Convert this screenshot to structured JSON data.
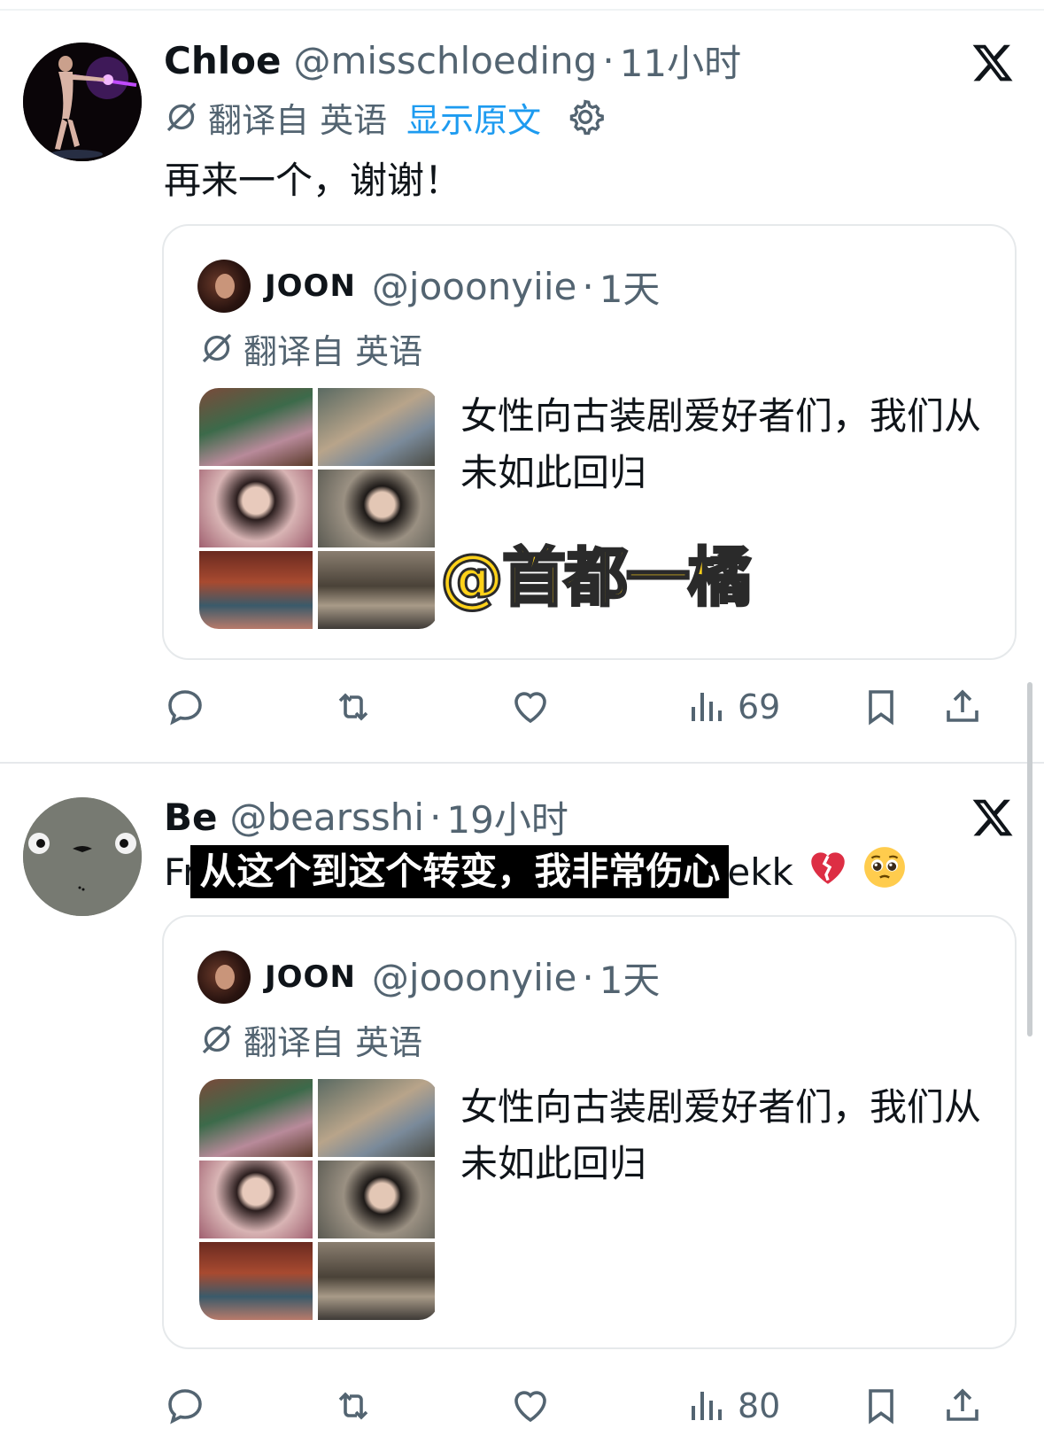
{
  "tweets": [
    {
      "author": {
        "name": "Chloe",
        "handle": "@misschloeding"
      },
      "separator": "·",
      "time": "11小时",
      "translate": {
        "label": "翻译自 英语",
        "show_original": "显示原文"
      },
      "text": "再来一个，谢谢！",
      "quote": {
        "author": {
          "name": "JOON",
          "handle": "@jooonyiie"
        },
        "separator": "·",
        "time": "1天",
        "translate_label": "翻译自 英语",
        "text": "女性向古装剧爱好者们，我们从未如此回归",
        "overlay_tag": "@首都一橘"
      },
      "views": "69"
    },
    {
      "author": {
        "name": "Be",
        "handle": "@bearsshi"
      },
      "separator": "·",
      "time": "19小时",
      "text_prefix": "Fr",
      "subtitle": "从这个到这个转变，我非常伤心",
      "text_suffix": "ekk",
      "emojis": [
        "💔",
        "🥺"
      ],
      "quote": {
        "author": {
          "name": "JOON",
          "handle": "@jooonyiie"
        },
        "separator": "·",
        "time": "1天",
        "translate_label": "翻译自 英语",
        "text": "女性向古装剧爱好者们，我们从未如此回归"
      },
      "views": "80"
    }
  ],
  "icons": {
    "x_logo": "x-logo-icon",
    "translate": "translate-icon",
    "settings": "gear-icon",
    "reply": "reply-icon",
    "retweet": "retweet-icon",
    "like": "heart-icon",
    "views": "views-icon",
    "bookmark": "bookmark-icon",
    "share": "share-icon"
  },
  "colors": {
    "text": "#0f1419",
    "secondary": "#536471",
    "link": "#1d9bf0",
    "border": "#e6e9eb",
    "tag_yellow": "#ffd21a"
  }
}
